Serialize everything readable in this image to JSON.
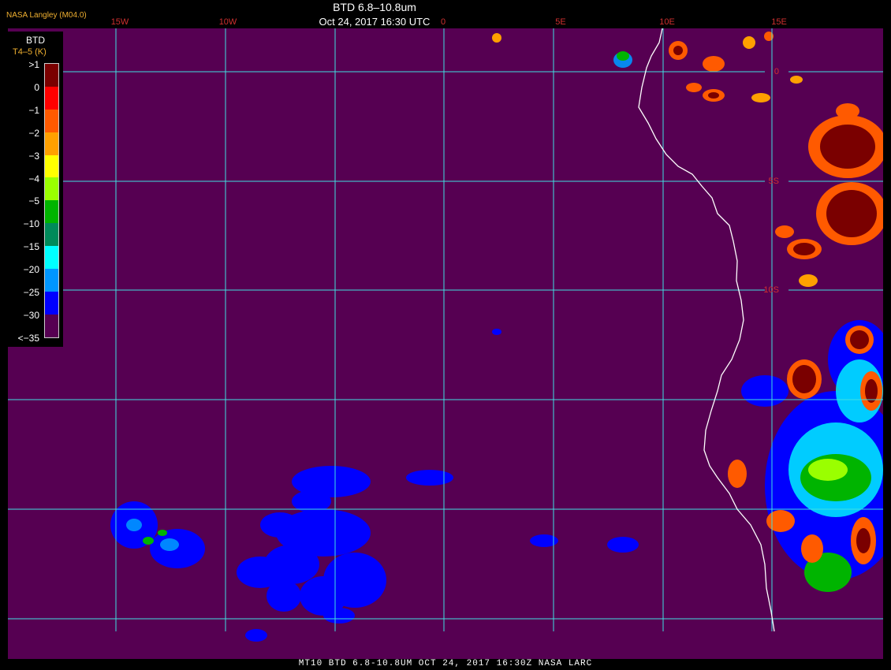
{
  "header": {
    "credit": "NASA Langley (M04.0)",
    "title": "BTD 6.8–10.8um",
    "timestamp": "Oct 24, 2017 16:30 UTC"
  },
  "legend": {
    "title": "BTD",
    "subtitle": "T4–5 (K)",
    "labels": [
      ">1",
      "0",
      "−1",
      "−2",
      "−3",
      "−4",
      "−5",
      "−10",
      "−15",
      "−20",
      "−25",
      "−30",
      "<−35"
    ],
    "colors": [
      "#7a0000",
      "#ff0000",
      "#ff5a00",
      "#ffa000",
      "#ffff00",
      "#9aff00",
      "#00b400",
      "#008a5a",
      "#00ffff",
      "#0096ff",
      "#0000ff",
      "#560052"
    ]
  },
  "grid": {
    "lon_labels": [
      "15W",
      "10W",
      "0",
      "5E",
      "10E",
      "15E"
    ],
    "lat_labels": [
      "0",
      "5S",
      "10S"
    ]
  },
  "footer": {
    "caption": "MT10  BTD 6.8-10.8UM  OCT 24, 2017 16:30Z  NASA LARC"
  },
  "colors": {
    "background": "#560052",
    "grid": "#40e0e0",
    "coast": "#ffffff",
    "label": "#d03030",
    "credit": "#f0b030"
  }
}
